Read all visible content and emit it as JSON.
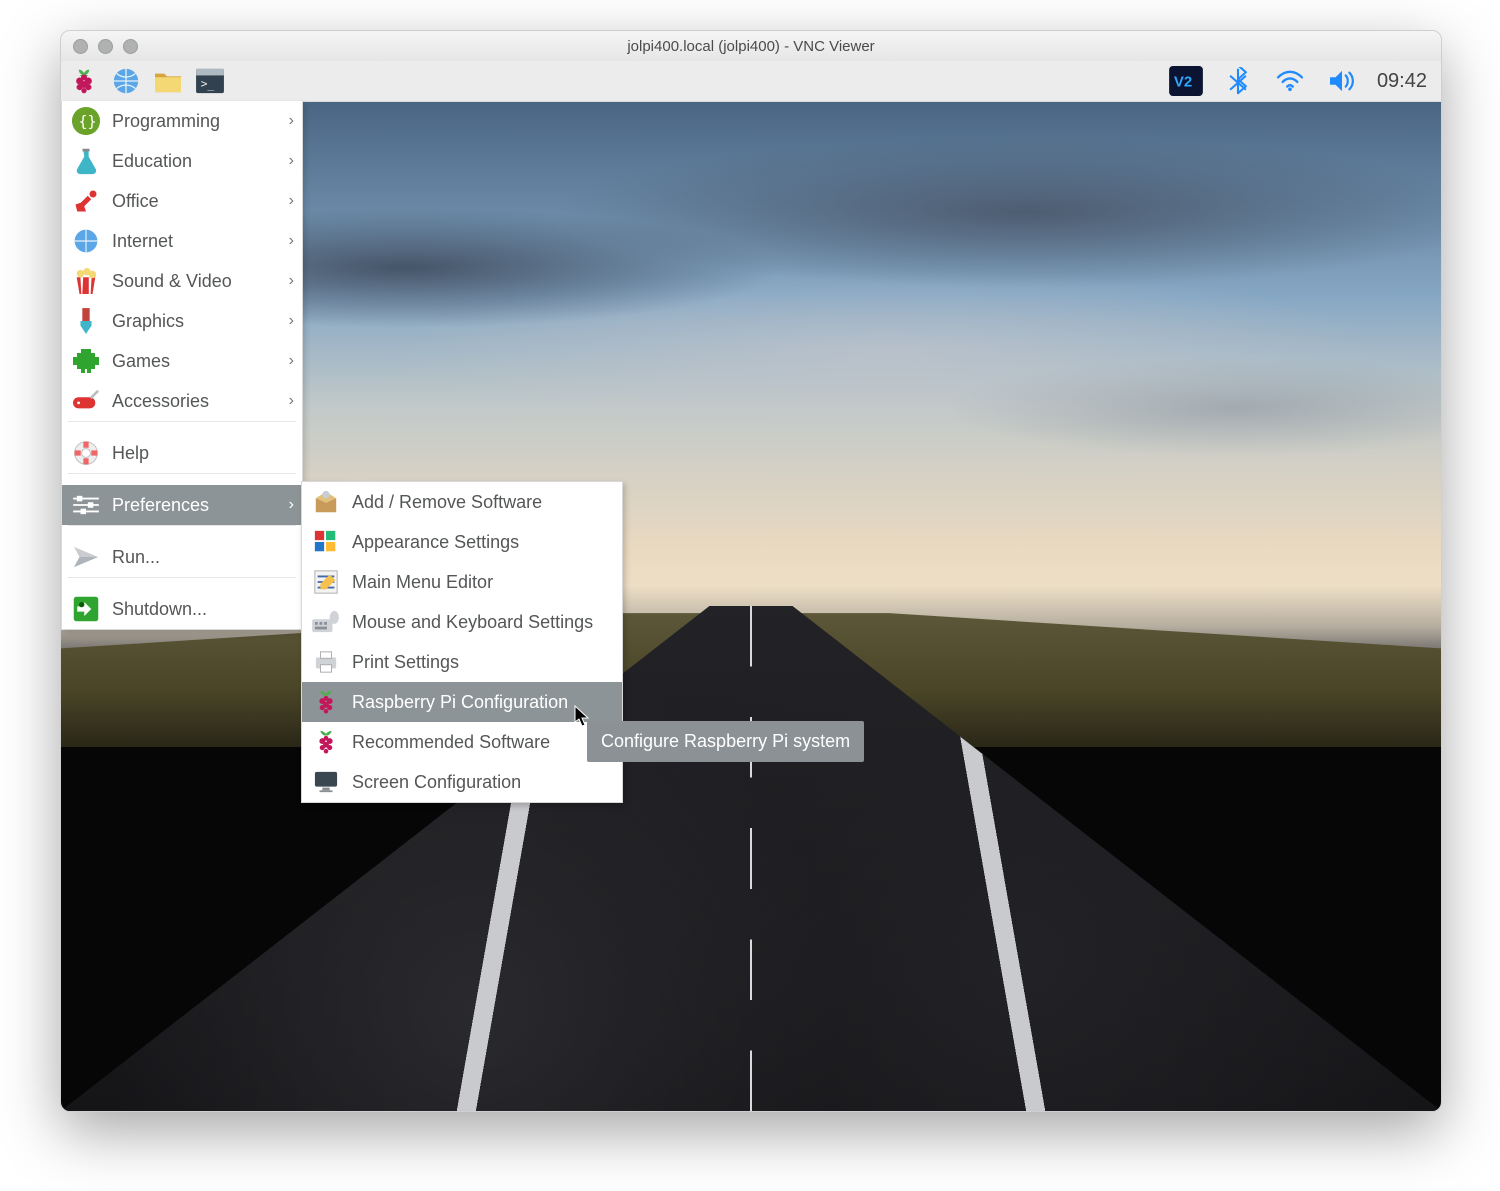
{
  "window": {
    "title": "jolpi400.local (jolpi400) - VNC Viewer"
  },
  "taskbar": {
    "launchers": [
      "raspberry-menu",
      "web-browser",
      "file-manager",
      "terminal"
    ],
    "tray": [
      "vnc-server",
      "bluetooth",
      "wifi",
      "volume"
    ],
    "clock": "09:42"
  },
  "main_menu": {
    "categories": [
      {
        "id": "programming",
        "label": "Programming",
        "icon": "braces-icon",
        "submenu": true
      },
      {
        "id": "education",
        "label": "Education",
        "icon": "flask-icon",
        "submenu": true
      },
      {
        "id": "office",
        "label": "Office",
        "icon": "lamp-icon",
        "submenu": true
      },
      {
        "id": "internet",
        "label": "Internet",
        "icon": "globe-icon",
        "submenu": true
      },
      {
        "id": "soundvideo",
        "label": "Sound & Video",
        "icon": "popcorn-icon",
        "submenu": true
      },
      {
        "id": "graphics",
        "label": "Graphics",
        "icon": "brush-icon",
        "submenu": true
      },
      {
        "id": "games",
        "label": "Games",
        "icon": "invader-icon",
        "submenu": true
      },
      {
        "id": "accessories",
        "label": "Accessories",
        "icon": "swiss-knife-icon",
        "submenu": true
      },
      {
        "id": "help",
        "label": "Help",
        "icon": "lifebuoy-icon",
        "submenu": false
      },
      {
        "id": "preferences",
        "label": "Preferences",
        "icon": "sliders-icon",
        "submenu": true,
        "selected": true
      },
      {
        "id": "run",
        "label": "Run...",
        "icon": "paperplane-icon",
        "submenu": false
      },
      {
        "id": "shutdown",
        "label": "Shutdown...",
        "icon": "exit-icon",
        "submenu": false
      }
    ]
  },
  "preferences_submenu": {
    "items": [
      {
        "id": "add-remove",
        "label": "Add / Remove Software",
        "icon": "package-icon"
      },
      {
        "id": "appearance",
        "label": "Appearance Settings",
        "icon": "appearance-icon"
      },
      {
        "id": "menu-editor",
        "label": "Main Menu Editor",
        "icon": "menu-editor-icon"
      },
      {
        "id": "mouse-kbd",
        "label": "Mouse and Keyboard Settings",
        "icon": "mouse-keyboard-icon"
      },
      {
        "id": "print",
        "label": "Print Settings",
        "icon": "printer-icon"
      },
      {
        "id": "rpi-config",
        "label": "Raspberry Pi Configuration",
        "icon": "raspberry-icon",
        "selected": true
      },
      {
        "id": "recommended",
        "label": "Recommended Software",
        "icon": "raspberry-icon"
      },
      {
        "id": "screen",
        "label": "Screen Configuration",
        "icon": "monitor-icon"
      }
    ]
  },
  "tooltip": {
    "text": "Configure Raspberry Pi system"
  }
}
